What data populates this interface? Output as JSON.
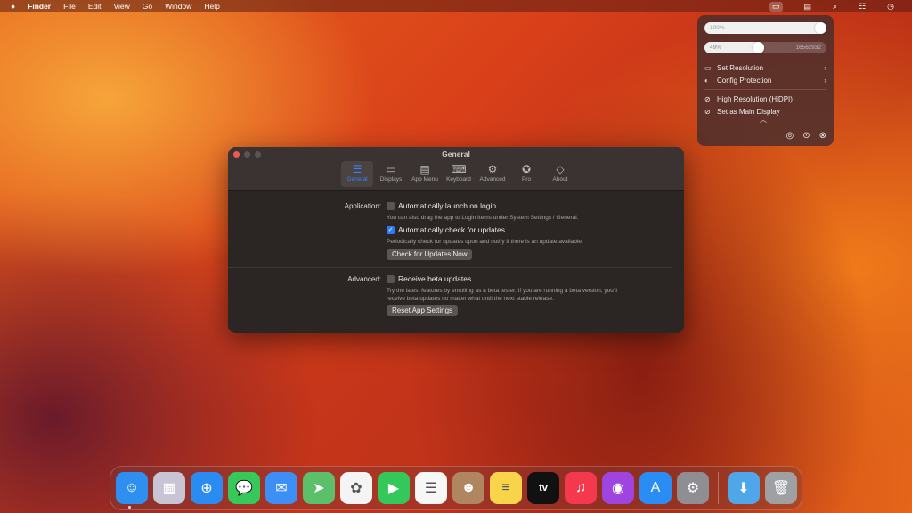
{
  "menubar": {
    "apple": "",
    "app": "Finder",
    "items": [
      "File",
      "Edit",
      "View",
      "Go",
      "Window",
      "Help"
    ],
    "status_icons": [
      "display-icon",
      "window-icon",
      "search-icon",
      "control-center-icon",
      "clock-icon"
    ]
  },
  "popup": {
    "brightness": "100%",
    "brightness_level": 100,
    "scale": "49%",
    "scale_level": 49,
    "resolution": "1656x932",
    "items": [
      {
        "label": "Set Resolution",
        "icon": "display-icon",
        "submenu": true
      },
      {
        "label": "Config Protection",
        "icon": "shield-icon",
        "submenu": true
      },
      {
        "label": "High Resolution (HiDPI)",
        "icon": "check-circle-icon"
      },
      {
        "label": "Set as Main Display",
        "icon": "check-circle-icon"
      }
    ],
    "footer_icons": [
      "settings-icon",
      "more-icon",
      "close-icon"
    ]
  },
  "window": {
    "title": "General",
    "tabs": [
      {
        "label": "General",
        "icon": "toggle-icon",
        "active": true
      },
      {
        "label": "Displays",
        "icon": "displays-icon"
      },
      {
        "label": "App Menu",
        "icon": "app-menu-icon"
      },
      {
        "label": "Keyboard",
        "icon": "keyboard-icon"
      },
      {
        "label": "Advanced",
        "icon": "gears-icon"
      },
      {
        "label": "Pro",
        "icon": "badge-check-icon"
      },
      {
        "label": "About",
        "icon": "tag-icon"
      }
    ],
    "application_label": "Application:",
    "launch_login": {
      "label": "Automatically launch on login",
      "checked": false,
      "hint": "You can also drag the app to Login Items under System Settings / General."
    },
    "check_updates": {
      "label": "Automatically check for updates",
      "checked": true,
      "hint": "Periodically check for updates upon and notify if there is an update available."
    },
    "check_now_button": "Check for Updates Now",
    "advanced_label": "Advanced:",
    "beta": {
      "label": "Receive beta updates",
      "checked": false,
      "hint1": "Try the latest features by enrolling as a beta tester. If you are running a beta version, you'll",
      "hint2": "receive beta updates no matter what until the next stable release."
    },
    "reset_button": "Reset App Settings"
  },
  "dock": [
    {
      "name": "Finder",
      "color": "#2f8ff0",
      "glyph": "☺"
    },
    {
      "name": "Launchpad",
      "color": "#c9c3d6",
      "glyph": "▦"
    },
    {
      "name": "Safari",
      "color": "#2a8cf0",
      "glyph": "⊕"
    },
    {
      "name": "Messages",
      "color": "#36c85a",
      "glyph": "💬"
    },
    {
      "name": "Mail",
      "color": "#3d8ef5",
      "glyph": "✉"
    },
    {
      "name": "Maps",
      "color": "#5cbf6a",
      "glyph": "➤"
    },
    {
      "name": "Photos",
      "color": "#f4f4f4",
      "glyph": "✿"
    },
    {
      "name": "FaceTime",
      "color": "#34c759",
      "glyph": "▶"
    },
    {
      "name": "Reminders",
      "color": "#f7f7f7",
      "glyph": "☰"
    },
    {
      "name": "Contacts",
      "color": "#b08660",
      "glyph": "☻"
    },
    {
      "name": "Notes",
      "color": "#f7d44a",
      "glyph": "≡"
    },
    {
      "name": "Apple TV",
      "color": "#111111",
      "glyph": "tv"
    },
    {
      "name": "Music",
      "color": "#f4394f",
      "glyph": "♫"
    },
    {
      "name": "Podcasts",
      "color": "#a044e0",
      "glyph": "◉"
    },
    {
      "name": "App Store",
      "color": "#2a8df5",
      "glyph": "A"
    },
    {
      "name": "System Settings",
      "color": "#8e8e93",
      "glyph": "⚙"
    },
    {
      "name": "Downloads",
      "color": "#4fa7ea",
      "glyph": "⬇"
    },
    {
      "name": "Trash",
      "color": "#9ea0a4",
      "glyph": "🗑"
    }
  ]
}
